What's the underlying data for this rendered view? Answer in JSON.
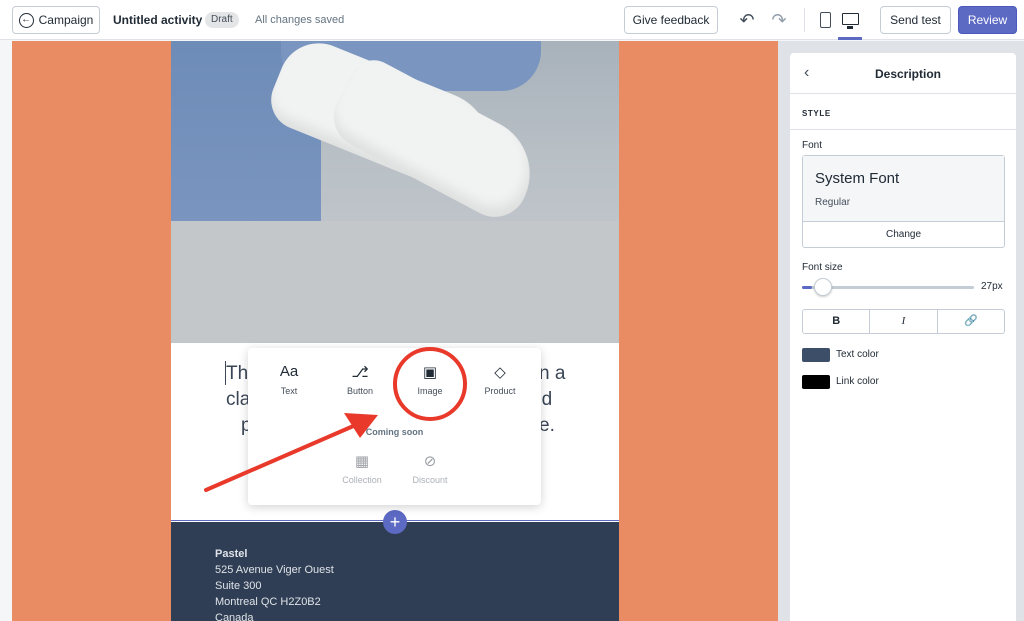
{
  "topbar": {
    "back_label": "Campaign",
    "title": "Untitled activity",
    "draft_badge": "Draft",
    "save_status": "All changes saved",
    "feedback_label": "Give feedback",
    "send_test_label": "Send test",
    "review_label": "Review"
  },
  "email": {
    "body_left": [
      "Th",
      "cla",
      "p"
    ],
    "body_right": [
      "n a",
      "nd",
      "e."
    ],
    "footer_lines": [
      "Pastel",
      "525 Avenue Viger Ouest",
      "Suite 300",
      "Montreal QC H2Z0B2",
      "Canada"
    ]
  },
  "popover": {
    "items": [
      {
        "label": "Text",
        "icon": "text-icon"
      },
      {
        "label": "Button",
        "icon": "button-icon"
      },
      {
        "label": "Image",
        "icon": "image-icon"
      },
      {
        "label": "Product",
        "icon": "tag-icon"
      }
    ],
    "coming_soon": "Coming soon",
    "disabled_items": [
      {
        "label": "Collection",
        "icon": "collection-icon"
      },
      {
        "label": "Discount",
        "icon": "discount-icon"
      }
    ]
  },
  "panel": {
    "title": "Description",
    "style_heading": "STYLE",
    "font_label": "Font",
    "font_name": "System Font",
    "font_variant": "Regular",
    "change_label": "Change",
    "font_size_label": "Font size",
    "font_size_value": "27px",
    "font_size_fraction": 0.06,
    "bold_label": "B",
    "italic_label": "I",
    "text_color_label": "Text color",
    "text_color": "#3d4e69",
    "link_color_label": "Link color",
    "link_color": "#000000"
  },
  "colors": {
    "accent": "#5c6ac4",
    "canvas_bg": "#e98c63",
    "footer_bg": "#2f3e54",
    "annotation": "#e8392b"
  }
}
